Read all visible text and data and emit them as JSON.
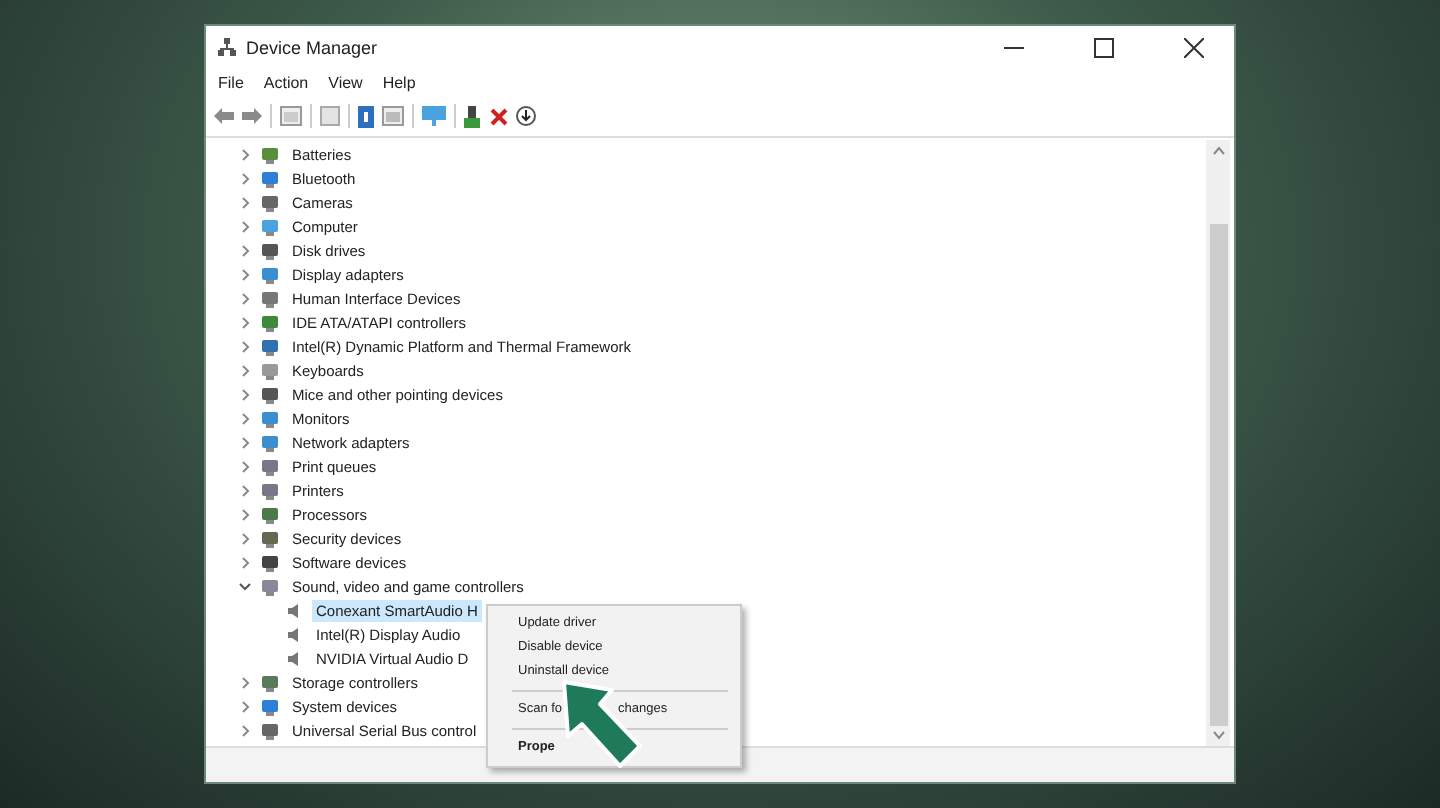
{
  "window": {
    "title": "Device Manager"
  },
  "menu_bar": [
    "File",
    "Action",
    "View",
    "Help"
  ],
  "tree": [
    {
      "label": "Batteries",
      "expanded": false
    },
    {
      "label": "Bluetooth",
      "expanded": false
    },
    {
      "label": "Cameras",
      "expanded": false
    },
    {
      "label": "Computer",
      "expanded": false
    },
    {
      "label": "Disk drives",
      "expanded": false
    },
    {
      "label": "Display adapters",
      "expanded": false
    },
    {
      "label": "Human Interface Devices",
      "expanded": false
    },
    {
      "label": "IDE ATA/ATAPI controllers",
      "expanded": false
    },
    {
      "label": "Intel(R) Dynamic Platform and Thermal Framework",
      "expanded": false
    },
    {
      "label": "Keyboards",
      "expanded": false
    },
    {
      "label": "Mice and other pointing devices",
      "expanded": false
    },
    {
      "label": "Monitors",
      "expanded": false
    },
    {
      "label": "Network adapters",
      "expanded": false
    },
    {
      "label": "Print queues",
      "expanded": false
    },
    {
      "label": "Printers",
      "expanded": false
    },
    {
      "label": "Processors",
      "expanded": false
    },
    {
      "label": "Security devices",
      "expanded": false
    },
    {
      "label": "Software devices",
      "expanded": false
    },
    {
      "label": "Sound, video and game controllers",
      "expanded": true,
      "children": [
        {
          "label": "Conexant SmartAudio H",
          "selected": true
        },
        {
          "label": "Intel(R) Display Audio",
          "selected": false
        },
        {
          "label": "NVIDIA Virtual Audio D",
          "selected": false
        }
      ]
    },
    {
      "label": "Storage controllers",
      "expanded": false
    },
    {
      "label": "System devices",
      "expanded": false
    },
    {
      "label": "Universal Serial Bus control",
      "expanded": false
    }
  ],
  "context_menu": [
    {
      "kind": "item",
      "label": "Update driver"
    },
    {
      "kind": "item",
      "label": "Disable device"
    },
    {
      "kind": "item",
      "label": "Uninstall device"
    },
    {
      "kind": "separator"
    },
    {
      "kind": "split",
      "label": "Scan fo",
      "label_end": "changes"
    },
    {
      "kind": "separator"
    },
    {
      "kind": "bold",
      "label": "Prope"
    }
  ]
}
